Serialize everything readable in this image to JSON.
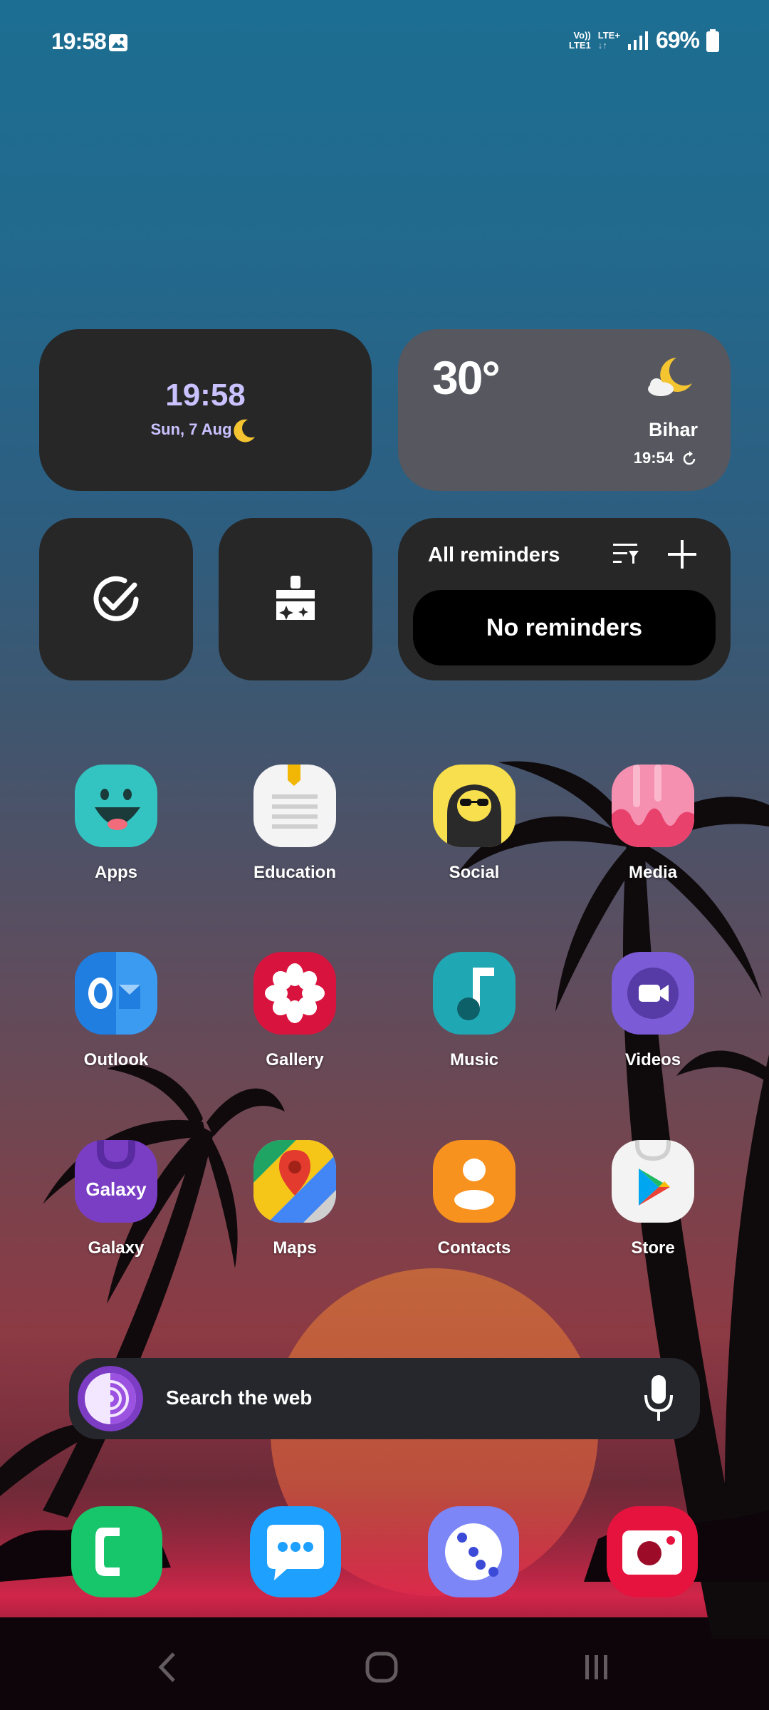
{
  "status_bar": {
    "time": "19:58",
    "volte_line1": "Vo))",
    "volte_line2": "LTE1",
    "lte_label": "LTE+",
    "battery": "69%"
  },
  "clock_widget": {
    "time": "19:58",
    "date": "Sun, 7 Aug"
  },
  "weather_widget": {
    "temperature": "30°",
    "location": "Bihar",
    "updated": "19:54"
  },
  "reminders_widget": {
    "title": "All reminders",
    "empty_text": "No reminders"
  },
  "apps": [
    {
      "label": "Apps"
    },
    {
      "label": "Education"
    },
    {
      "label": "Social"
    },
    {
      "label": "Media"
    },
    {
      "label": "Outlook"
    },
    {
      "label": "Gallery"
    },
    {
      "label": "Music"
    },
    {
      "label": "Videos"
    },
    {
      "label": "Galaxy"
    },
    {
      "label": "Maps"
    },
    {
      "label": "Contacts"
    },
    {
      "label": "Store"
    }
  ],
  "galaxy_icon_text": "Galaxy",
  "search": {
    "placeholder": "Search the web"
  },
  "colors": {
    "clock_accent": "#c9c2ff",
    "phone_green": "#17c56a",
    "messages_blue": "#1ea0ff",
    "bixby_purple": "#7c86f6",
    "camera_red": "#e5133d"
  }
}
